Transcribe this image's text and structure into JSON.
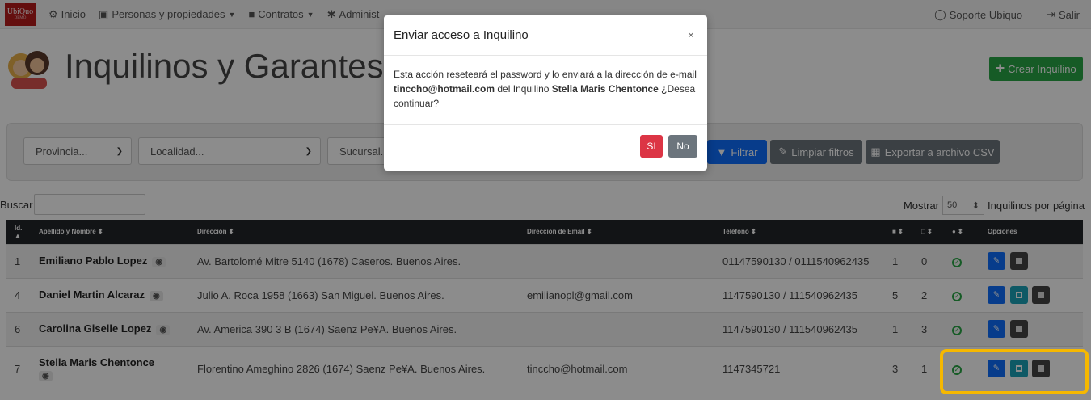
{
  "logo": {
    "text": "UbiQuo",
    "sub": "DEMO"
  },
  "nav": {
    "items": [
      {
        "label": "Inicio"
      },
      {
        "label": "Personas y propiedades"
      },
      {
        "label": "Contratos"
      },
      {
        "label": "Administ"
      }
    ],
    "right": [
      {
        "label": "Soporte Ubiquo"
      },
      {
        "label": "Salir"
      }
    ]
  },
  "page": {
    "title": "Inquilinos y Garantes",
    "create_label": "Crear Inquilino"
  },
  "filters": {
    "provincia": "Provincia...",
    "localidad": "Localidad...",
    "sucursal": "Sucursal...",
    "filtrar": "Filtrar",
    "limpiar": "Limpiar filtros",
    "exportar": "Exportar a archivo CSV"
  },
  "search": {
    "label": "Buscar"
  },
  "paging": {
    "show_label": "Mostrar",
    "value": "50",
    "suffix": "Inquilinos por página"
  },
  "table": {
    "headers": [
      "Id.",
      "Apellido y Nombre",
      "Dirección",
      "Dirección de Email",
      "Teléfono",
      "",
      "",
      "",
      "Opciones"
    ],
    "rows": [
      {
        "id": "1",
        "name": "Emiliano Pablo Lopez",
        "address": "Av. Bartolomé Mitre 5140 (1678) Caseros. Buenos Aires.",
        "email": "",
        "phone": "01147590130 / 0111540962435",
        "c1": "1",
        "c2": "0"
      },
      {
        "id": "4",
        "name": "Daniel Martin Alcaraz",
        "address": "Julio A. Roca 1958 (1663) San Miguel. Buenos Aires.",
        "email": "emilianopl@gmail.com",
        "phone": "1147590130 / 111540962435",
        "c1": "5",
        "c2": "2"
      },
      {
        "id": "6",
        "name": "Carolina Giselle Lopez",
        "address": "Av. America 390 3 B (1674) Saenz Pe¥A. Buenos Aires.",
        "email": "",
        "phone": "1147590130 / 111540962435",
        "c1": "1",
        "c2": "3"
      },
      {
        "id": "7",
        "name": "Stella Maris Chentonce",
        "address": "Florentino Ameghino 2826 (1674) Saenz Pe¥A. Buenos Aires.",
        "email": "tinccho@hotmail.com",
        "phone": "1147345721",
        "c1": "3",
        "c2": "1"
      }
    ]
  },
  "modal": {
    "title": "Enviar acceso a Inquilino",
    "body_1": "Esta acción reseteará el password y lo enviará a la dirección de e-mail ",
    "email": "tinccho@hotmail.com",
    "body_2": " del Inquilino ",
    "name": "Stella Maris Chentonce",
    "body_3": " ¿Desea continuar?",
    "yes": "SI",
    "no": "No",
    "close": "×"
  },
  "colors": {
    "nav_bg": "#f5f5f5",
    "create": "#28a745",
    "filter": "#0d6efd",
    "gray_btn": "#6c757d",
    "yes": "#dc3545",
    "highlight": "#f6b800"
  }
}
